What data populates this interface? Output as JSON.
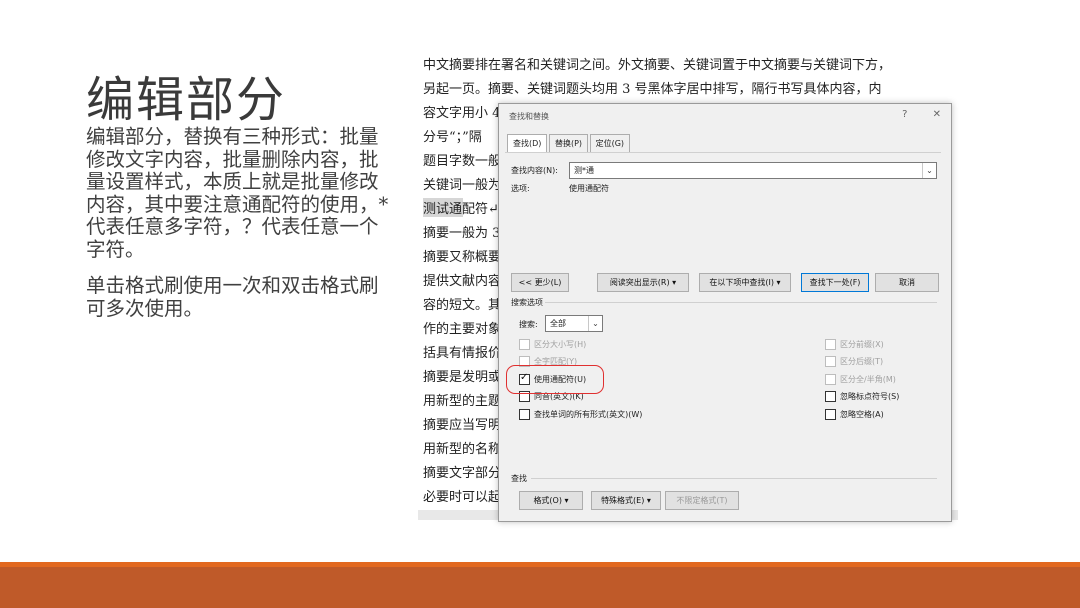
{
  "slide": {
    "title": "编辑部分",
    "paragraph1": "编辑部分，替换有三种形式：批量修改文字内容，批量删除内容，批量设置样式，本质上就是批量修改内容，其中要注意通配符的使用，*代表任意多字符，？代表任意一个字符。",
    "paragraph2": "单击格式刷使用一次和双击格式刷可多次使用。"
  },
  "document": {
    "lines": [
      "中文摘要排在署名和关键词之间。外文摘要、关键词置于中文摘要与关键词下方，",
      "另起一页。摘要、关键词题头均用 3 号黑体字居中排写，隔行书写具体内容，内",
      "容文字用小 4",
      "分号“；”隔",
      "题目字数一般",
      "关键词一般为",
      "测试通配符↵",
      "摘要一般为 3",
      "摘要又称概要",
      "提供文献内容",
      "容的短文。其",
      "作的主要对象",
      "括具有情报价",
      "摘要是发明或",
      "用新型的主题",
      "摘要应当写明",
      "用新型的名称",
      "摘要文字部分",
      "必要时可以起"
    ],
    "highlight_text": "测试通"
  },
  "dialog": {
    "title": "查找和替换",
    "help_glyph": "?",
    "close_glyph": "✕",
    "tabs": [
      "查找(D)",
      "替换(P)",
      "定位(G)"
    ],
    "find_label": "查找内容(N):",
    "find_value": "测*通",
    "options_label": "选项:",
    "options_value": "使用通配符",
    "buttons": {
      "less": "<< 更少(L)",
      "reading_highlight": "阅读突出显示(R) ▾",
      "find_in": "在以下项中查找(I) ▾",
      "find_next": "查找下一处(F)",
      "cancel": "取消"
    },
    "search_options_label": "搜索选项",
    "search_label": "搜索:",
    "search_value": "全部",
    "left_checks": [
      {
        "label": "区分大小写(H)",
        "checked": false,
        "disabled": true
      },
      {
        "label": "全字匹配(Y)",
        "checked": false,
        "disabled": true
      },
      {
        "label": "使用通配符(U)",
        "checked": true,
        "disabled": false
      },
      {
        "label": "同音(英文)(K)",
        "checked": false,
        "disabled": false
      },
      {
        "label": "查找单词的所有形式(英文)(W)",
        "checked": false,
        "disabled": false
      }
    ],
    "right_checks": [
      {
        "label": "区分前缀(X)",
        "checked": false,
        "disabled": true
      },
      {
        "label": "区分后缀(T)",
        "checked": false,
        "disabled": true
      },
      {
        "label": "区分全/半角(M)",
        "checked": false,
        "disabled": true
      },
      {
        "label": "忽略标点符号(S)",
        "checked": false,
        "disabled": false
      },
      {
        "label": "忽略空格(A)",
        "checked": false,
        "disabled": false
      }
    ],
    "find_section_label": "查找",
    "bottom_buttons": {
      "format": "格式(O) ▾",
      "special": "特殊格式(E) ▾",
      "no_format": "不限定格式(T)"
    }
  },
  "colors": {
    "accent_thin": "#e2681f",
    "accent_bar": "#bf5a29",
    "highlight_circle": "#e03030"
  }
}
